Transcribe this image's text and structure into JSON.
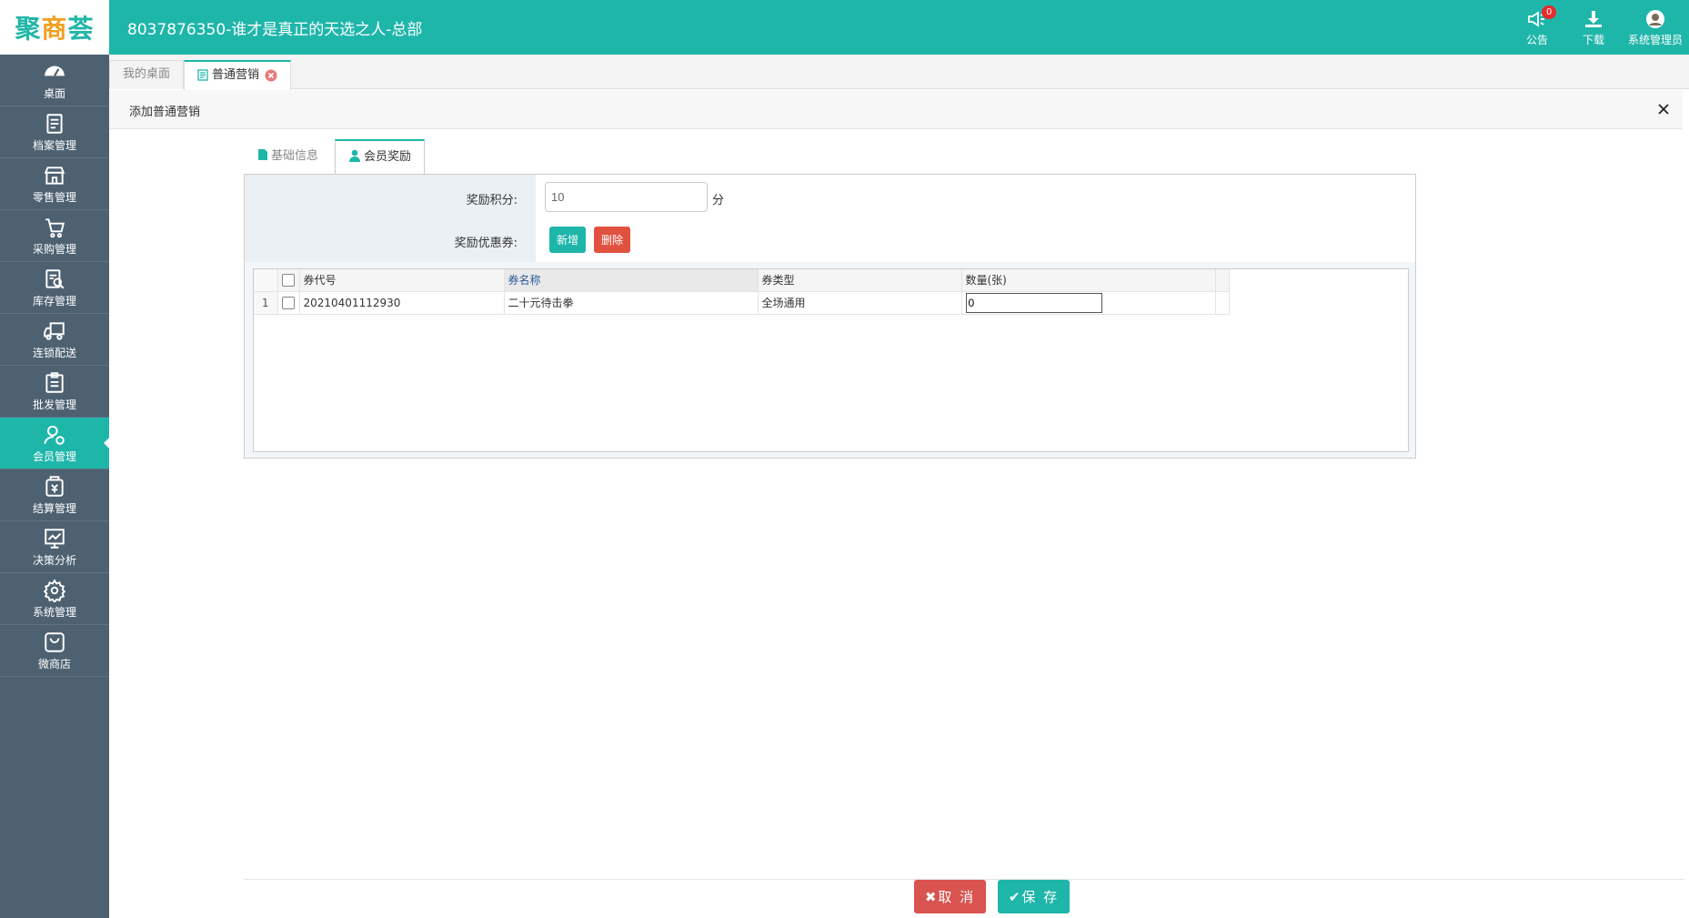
{
  "brand": {
    "logo_chars": [
      "聚",
      "商",
      "荟"
    ],
    "accent_color": "#1fb6aa",
    "sidebar_color": "#4d6171"
  },
  "header": {
    "title": "8037876350-谁才是真正的天选之人-总部",
    "actions": [
      {
        "label": "公告",
        "icon": "megaphone-icon",
        "badge": "0"
      },
      {
        "label": "下载",
        "icon": "download-icon"
      },
      {
        "label": "系统管理员",
        "icon": "user-avatar-icon"
      }
    ]
  },
  "sidebar": {
    "items": [
      {
        "label": "桌面",
        "icon": "dashboard-icon"
      },
      {
        "label": "档案管理",
        "icon": "archive-icon"
      },
      {
        "label": "零售管理",
        "icon": "store-icon"
      },
      {
        "label": "采购管理",
        "icon": "cart-icon"
      },
      {
        "label": "库存管理",
        "icon": "inventory-icon"
      },
      {
        "label": "连锁配送",
        "icon": "truck-icon"
      },
      {
        "label": "批发管理",
        "icon": "wholesale-icon"
      },
      {
        "label": "会员管理",
        "icon": "member-icon",
        "active": true
      },
      {
        "label": "结算管理",
        "icon": "settlement-icon"
      },
      {
        "label": "决策分析",
        "icon": "chart-icon"
      },
      {
        "label": "系统管理",
        "icon": "settings-icon"
      },
      {
        "label": "微商店",
        "icon": "shop-bag-icon"
      }
    ]
  },
  "page_tabs": [
    {
      "label": "我的桌面"
    },
    {
      "label": "普通营销",
      "active": true
    }
  ],
  "panel": {
    "title": "添加普通营销"
  },
  "inner_tabs": [
    {
      "label": "基础信息",
      "icon": "document-icon"
    },
    {
      "label": "会员奖励",
      "icon": "user-icon",
      "active": true
    }
  ],
  "form": {
    "points_label": "奖励积分:",
    "points_value": "10",
    "points_unit": "分",
    "coupon_label": "奖励优惠券:",
    "add_label": "新增",
    "delete_label": "删除"
  },
  "grid": {
    "columns": [
      "券代号",
      "券名称",
      "券类型",
      "数量(张)"
    ],
    "rows": [
      {
        "num": "1",
        "code": "20210401112930",
        "name": "二十元待击拳",
        "type": "全场通用",
        "qty": "0"
      }
    ]
  },
  "footer": {
    "cancel_label": "取 消",
    "save_label": "保 存"
  }
}
